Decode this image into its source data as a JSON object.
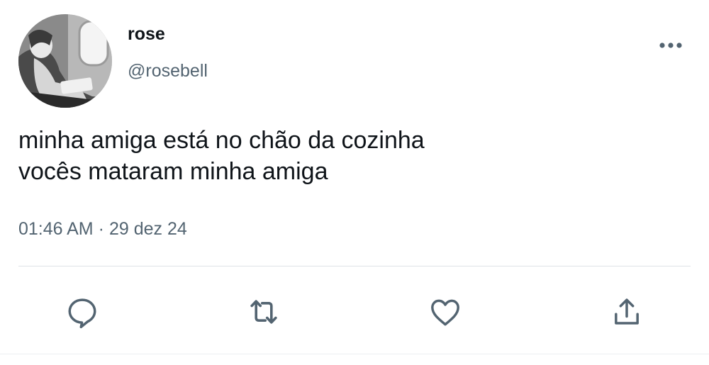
{
  "tweet": {
    "author": {
      "display_name": "rose",
      "handle": "@rosebell",
      "avatar_description": "grayscale photo of a person reading by an airplane window"
    },
    "text_lines": [
      "minha amiga está no chão da cozinha",
      "vocês mataram minha amiga"
    ],
    "time": "01:46 AM",
    "separator": "·",
    "date": "29 dez 24"
  },
  "actions": [
    {
      "icon": "reply-icon"
    },
    {
      "icon": "retweet-icon"
    },
    {
      "icon": "like-icon"
    },
    {
      "icon": "share-icon"
    }
  ],
  "colors": {
    "primary_text": "#0f1419",
    "secondary_text": "#536471",
    "icon": "#536471",
    "divider": "#dfe3e6",
    "background": "#ffffff"
  }
}
